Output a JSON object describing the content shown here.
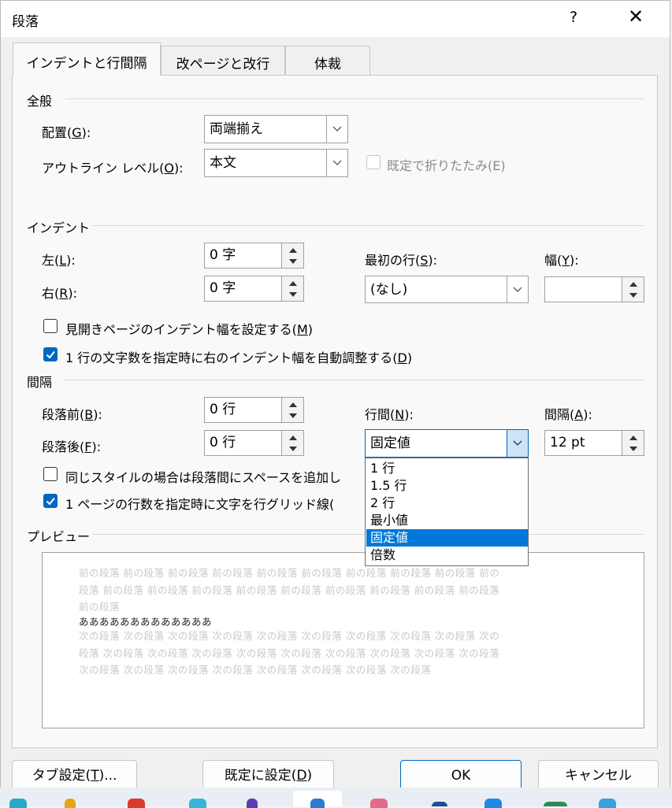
{
  "dialog": {
    "title": "段落",
    "help": "?",
    "close": "✕"
  },
  "tabs": [
    {
      "label": "インデントと行間隔"
    },
    {
      "label": "改ページと改行"
    },
    {
      "label": "体裁"
    }
  ],
  "general": {
    "heading": "全般",
    "alignment": {
      "label": "配置(",
      "key": "G",
      "suffix": "):",
      "value": "両端揃え"
    },
    "outline": {
      "label": "アウトライン レベル(",
      "key": "O",
      "suffix": "):",
      "value": "本文"
    },
    "collapse": {
      "label": "既定で折りたたみ(E)"
    }
  },
  "indent": {
    "heading": "インデント",
    "left": {
      "label": "左(",
      "key": "L",
      "suffix": "):",
      "value": "0 字"
    },
    "right": {
      "label": "右(",
      "key": "R",
      "suffix": "):",
      "value": "0 字"
    },
    "first_line": {
      "label": "最初の行(",
      "key": "S",
      "suffix": "):",
      "value": "(なし)"
    },
    "width": {
      "label": "幅(",
      "key": "Y",
      "suffix": "):",
      "value": ""
    },
    "mirror": {
      "label_pre": "見開きページのインデント幅を設定する(",
      "key": "M",
      "label_post": ")"
    },
    "auto_adjust": {
      "label_pre": "1 行の文字数を指定時に右のインデント幅を自動調整する(",
      "key": "D",
      "label_post": ")"
    }
  },
  "spacing": {
    "heading": "間隔",
    "before": {
      "label": "段落前(",
      "key": "B",
      "suffix": "):",
      "value": "0 行"
    },
    "after": {
      "label": "段落後(",
      "key": "F",
      "suffix": "):",
      "value": "0 行"
    },
    "line_spacing": {
      "label": "行間(",
      "key": "N",
      "suffix": "):",
      "value": "固定値"
    },
    "at": {
      "label": "間隔(",
      "key": "A",
      "suffix": "):",
      "value": "12 pt"
    },
    "no_space_same_style": {
      "label": "同じスタイルの場合は段落間にスペースを追加し"
    },
    "snap_grid": {
      "label": "1 ページの行数を指定時に文字を行グリッド線("
    }
  },
  "line_spacing_options": [
    "1 行",
    "1.5 行",
    "2 行",
    "最小値",
    "固定値",
    "倍数"
  ],
  "preview": {
    "heading": "プレビュー",
    "lines": [
      "前の段落 前の段落 前の段落 前の段落 前の段落 前の段落 前の段落 前の段落 前の段落 前の",
      "段落 前の段落 前の段落 前の段落 前の段落 前の段落 前の段落 前の段落 前の段落 前の段落",
      "前の段落",
      "あああああああああああああ",
      "次の段落 次の段落 次の段落 次の段落 次の段落 次の段落 次の段落 次の段落 次の段落 次の",
      "段落 次の段落 次の段落 次の段落 次の段落 次の段落 次の段落 次の段落 次の段落 次の段落",
      "次の段落 次の段落 次の段落 次の段落 次の段落 次の段落 次の段落 次の段落"
    ]
  },
  "buttons": {
    "tabs": {
      "label_pre": "タブ設定(",
      "key": "T",
      "label_post": ")..."
    },
    "set_default": {
      "label_pre": "既定に設定(",
      "key": "D",
      "label_post": ")"
    },
    "ok": "OK",
    "cancel": "キャンセル"
  },
  "colors": {
    "accent": "#0067c0",
    "selection": "#0078d7"
  }
}
